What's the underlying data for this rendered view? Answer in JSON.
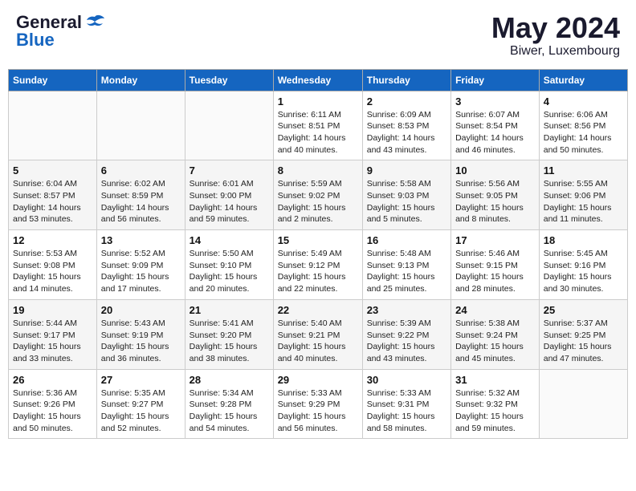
{
  "logo": {
    "line1": "General",
    "line2": "Blue"
  },
  "title": "May 2024",
  "subtitle": "Biwer, Luxembourg",
  "days_of_week": [
    "Sunday",
    "Monday",
    "Tuesday",
    "Wednesday",
    "Thursday",
    "Friday",
    "Saturday"
  ],
  "weeks": [
    [
      {
        "day": "",
        "info": ""
      },
      {
        "day": "",
        "info": ""
      },
      {
        "day": "",
        "info": ""
      },
      {
        "day": "1",
        "info": "Sunrise: 6:11 AM\nSunset: 8:51 PM\nDaylight: 14 hours\nand 40 minutes."
      },
      {
        "day": "2",
        "info": "Sunrise: 6:09 AM\nSunset: 8:53 PM\nDaylight: 14 hours\nand 43 minutes."
      },
      {
        "day": "3",
        "info": "Sunrise: 6:07 AM\nSunset: 8:54 PM\nDaylight: 14 hours\nand 46 minutes."
      },
      {
        "day": "4",
        "info": "Sunrise: 6:06 AM\nSunset: 8:56 PM\nDaylight: 14 hours\nand 50 minutes."
      }
    ],
    [
      {
        "day": "5",
        "info": "Sunrise: 6:04 AM\nSunset: 8:57 PM\nDaylight: 14 hours\nand 53 minutes."
      },
      {
        "day": "6",
        "info": "Sunrise: 6:02 AM\nSunset: 8:59 PM\nDaylight: 14 hours\nand 56 minutes."
      },
      {
        "day": "7",
        "info": "Sunrise: 6:01 AM\nSunset: 9:00 PM\nDaylight: 14 hours\nand 59 minutes."
      },
      {
        "day": "8",
        "info": "Sunrise: 5:59 AM\nSunset: 9:02 PM\nDaylight: 15 hours\nand 2 minutes."
      },
      {
        "day": "9",
        "info": "Sunrise: 5:58 AM\nSunset: 9:03 PM\nDaylight: 15 hours\nand 5 minutes."
      },
      {
        "day": "10",
        "info": "Sunrise: 5:56 AM\nSunset: 9:05 PM\nDaylight: 15 hours\nand 8 minutes."
      },
      {
        "day": "11",
        "info": "Sunrise: 5:55 AM\nSunset: 9:06 PM\nDaylight: 15 hours\nand 11 minutes."
      }
    ],
    [
      {
        "day": "12",
        "info": "Sunrise: 5:53 AM\nSunset: 9:08 PM\nDaylight: 15 hours\nand 14 minutes."
      },
      {
        "day": "13",
        "info": "Sunrise: 5:52 AM\nSunset: 9:09 PM\nDaylight: 15 hours\nand 17 minutes."
      },
      {
        "day": "14",
        "info": "Sunrise: 5:50 AM\nSunset: 9:10 PM\nDaylight: 15 hours\nand 20 minutes."
      },
      {
        "day": "15",
        "info": "Sunrise: 5:49 AM\nSunset: 9:12 PM\nDaylight: 15 hours\nand 22 minutes."
      },
      {
        "day": "16",
        "info": "Sunrise: 5:48 AM\nSunset: 9:13 PM\nDaylight: 15 hours\nand 25 minutes."
      },
      {
        "day": "17",
        "info": "Sunrise: 5:46 AM\nSunset: 9:15 PM\nDaylight: 15 hours\nand 28 minutes."
      },
      {
        "day": "18",
        "info": "Sunrise: 5:45 AM\nSunset: 9:16 PM\nDaylight: 15 hours\nand 30 minutes."
      }
    ],
    [
      {
        "day": "19",
        "info": "Sunrise: 5:44 AM\nSunset: 9:17 PM\nDaylight: 15 hours\nand 33 minutes."
      },
      {
        "day": "20",
        "info": "Sunrise: 5:43 AM\nSunset: 9:19 PM\nDaylight: 15 hours\nand 36 minutes."
      },
      {
        "day": "21",
        "info": "Sunrise: 5:41 AM\nSunset: 9:20 PM\nDaylight: 15 hours\nand 38 minutes."
      },
      {
        "day": "22",
        "info": "Sunrise: 5:40 AM\nSunset: 9:21 PM\nDaylight: 15 hours\nand 40 minutes."
      },
      {
        "day": "23",
        "info": "Sunrise: 5:39 AM\nSunset: 9:22 PM\nDaylight: 15 hours\nand 43 minutes."
      },
      {
        "day": "24",
        "info": "Sunrise: 5:38 AM\nSunset: 9:24 PM\nDaylight: 15 hours\nand 45 minutes."
      },
      {
        "day": "25",
        "info": "Sunrise: 5:37 AM\nSunset: 9:25 PM\nDaylight: 15 hours\nand 47 minutes."
      }
    ],
    [
      {
        "day": "26",
        "info": "Sunrise: 5:36 AM\nSunset: 9:26 PM\nDaylight: 15 hours\nand 50 minutes."
      },
      {
        "day": "27",
        "info": "Sunrise: 5:35 AM\nSunset: 9:27 PM\nDaylight: 15 hours\nand 52 minutes."
      },
      {
        "day": "28",
        "info": "Sunrise: 5:34 AM\nSunset: 9:28 PM\nDaylight: 15 hours\nand 54 minutes."
      },
      {
        "day": "29",
        "info": "Sunrise: 5:33 AM\nSunset: 9:29 PM\nDaylight: 15 hours\nand 56 minutes."
      },
      {
        "day": "30",
        "info": "Sunrise: 5:33 AM\nSunset: 9:31 PM\nDaylight: 15 hours\nand 58 minutes."
      },
      {
        "day": "31",
        "info": "Sunrise: 5:32 AM\nSunset: 9:32 PM\nDaylight: 15 hours\nand 59 minutes."
      },
      {
        "day": "",
        "info": ""
      }
    ]
  ]
}
